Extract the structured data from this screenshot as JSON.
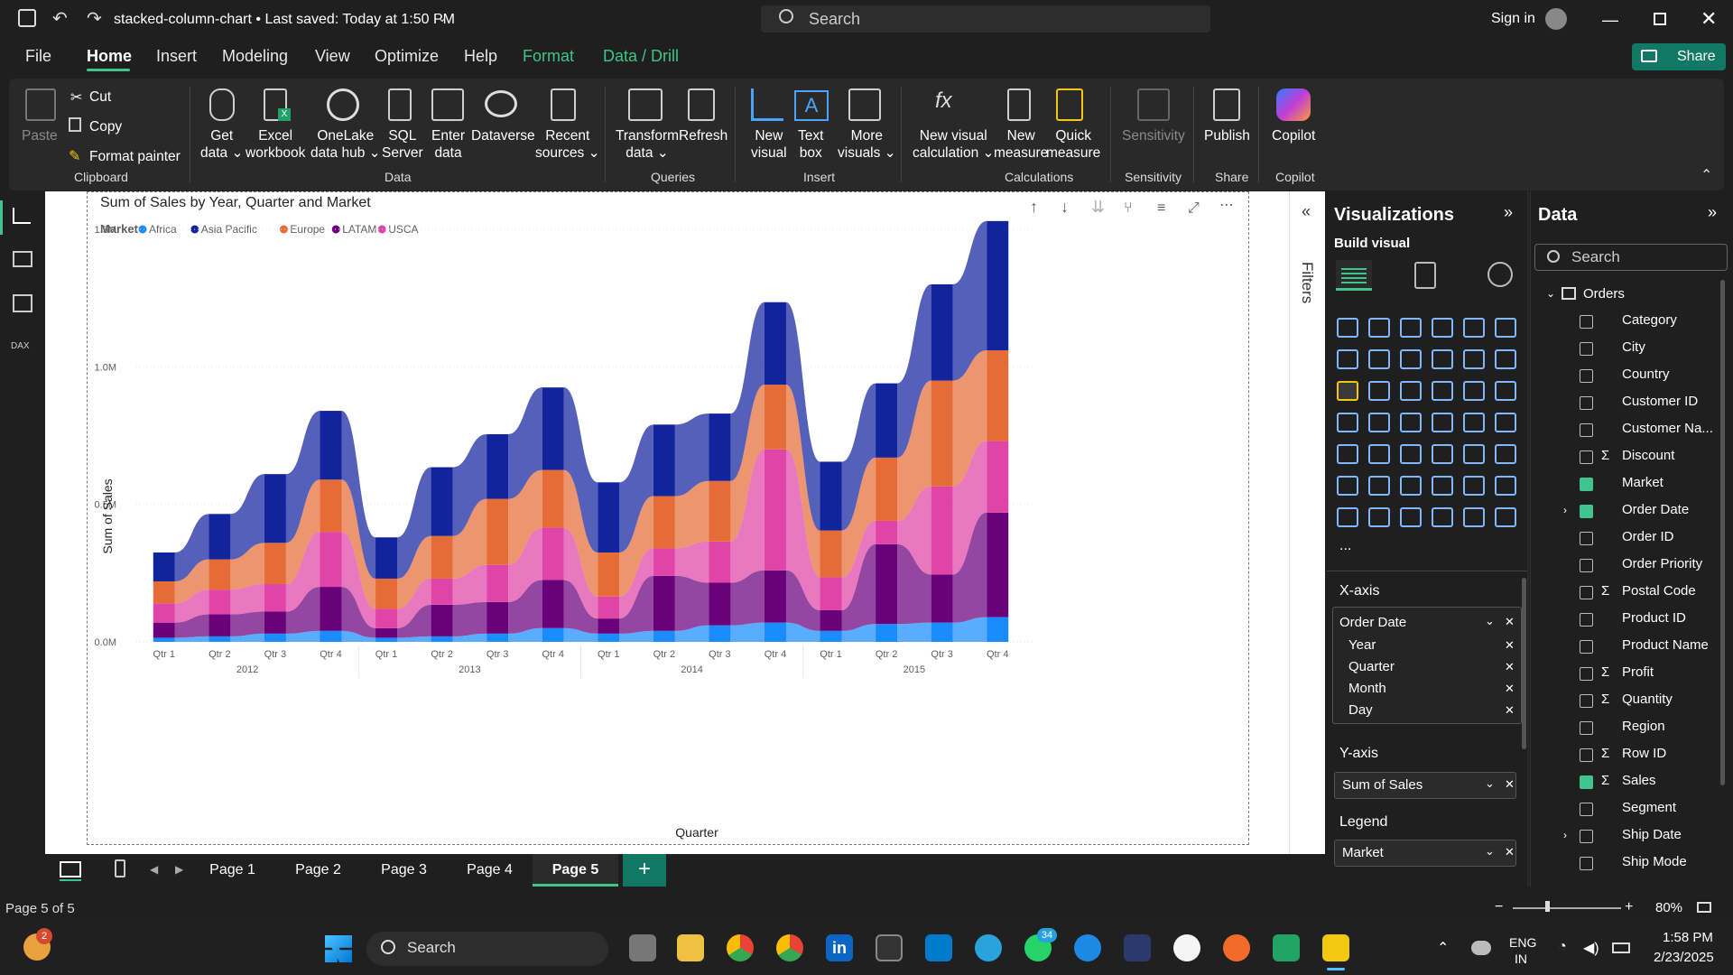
{
  "app": {
    "title": "stacked-column-chart • Last saved: Today at 1:50 PM",
    "search": "Search",
    "sign_in": "Sign in"
  },
  "menu": [
    "File",
    "Home",
    "Insert",
    "Modeling",
    "View",
    "Optimize",
    "Help",
    "Format",
    "Data / Drill"
  ],
  "share": "Share",
  "ribbon": {
    "paste": "Paste",
    "cut": "Cut",
    "copy": "Copy",
    "format_painter": "Format painter",
    "clipboard": "Clipboard",
    "get_data": [
      "Get",
      "data ⌄"
    ],
    "excel": [
      "Excel",
      "workbook"
    ],
    "onelake": [
      "OneLake",
      "data hub ⌄"
    ],
    "sql": [
      "SQL",
      "Server"
    ],
    "enter": [
      "Enter",
      "data"
    ],
    "dataverse": "Dataverse",
    "recent": [
      "Recent",
      "sources ⌄"
    ],
    "data_group": "Data",
    "transform": [
      "Transform",
      "data ⌄"
    ],
    "refresh": "Refresh",
    "queries_group": "Queries",
    "new_visual": [
      "New",
      "visual"
    ],
    "text_box": [
      "Text",
      "box"
    ],
    "more_visuals": [
      "More",
      "visuals ⌄"
    ],
    "insert_group": "Insert",
    "new_visual_calc": [
      "New visual",
      "calculation ⌄"
    ],
    "new_measure": [
      "New",
      "measure"
    ],
    "quick_measure": [
      "Quick",
      "measure"
    ],
    "calculations_group": "Calculations",
    "sensitivity": "Sensitivity",
    "sensitivity_group": "Sensitivity",
    "publish": "Publish",
    "share_group": "Share",
    "copilot": "Copilot",
    "copilot_group": "Copilot"
  },
  "chart_data": {
    "type": "ribbon-stacked-column",
    "title": "Sum of Sales by Year, Quarter and Market",
    "legend_title": "Market",
    "legend_position": "top-left",
    "xlabel": "Quarter",
    "ylabel": "Sum of Sales",
    "ylim": [
      0,
      1500000
    ],
    "y_ticks": [
      "0.0M",
      "0.5M",
      "1.0M",
      "1.5M"
    ],
    "categories": [
      "Qtr 1",
      "Qtr 2",
      "Qtr 3",
      "Qtr 4",
      "Qtr 1",
      "Qtr 2",
      "Qtr 3",
      "Qtr 4",
      "Qtr 1",
      "Qtr 2",
      "Qtr 3",
      "Qtr 4",
      "Qtr 1",
      "Qtr 2",
      "Qtr 3",
      "Qtr 4"
    ],
    "years": [
      "2012",
      "2013",
      "2014",
      "2015"
    ],
    "series": [
      {
        "name": "Africa",
        "color": "#1a8cff",
        "values": [
          15000,
          20000,
          30000,
          40000,
          15000,
          20000,
          30000,
          50000,
          30000,
          40000,
          60000,
          70000,
          40000,
          65000,
          70000,
          90000
        ]
      },
      {
        "name": "LATAM",
        "color": "#6b007b",
        "values": [
          55000,
          80000,
          80000,
          160000,
          35000,
          115000,
          115000,
          175000,
          55000,
          200000,
          155000,
          190000,
          75000,
          290000,
          175000,
          380000
        ]
      },
      {
        "name": "USCA",
        "color": "#e044a7",
        "values": [
          70000,
          90000,
          100000,
          200000,
          70000,
          95000,
          135000,
          190000,
          80000,
          100000,
          150000,
          440000,
          120000,
          85000,
          320000,
          260000
        ]
      },
      {
        "name": "Europe",
        "color": "#e66c37",
        "values": [
          80000,
          110000,
          150000,
          190000,
          110000,
          155000,
          240000,
          210000,
          160000,
          190000,
          220000,
          235000,
          170000,
          230000,
          385000,
          330000
        ]
      },
      {
        "name": "Asia Pacific",
        "color": "#12239e",
        "values": [
          105000,
          165000,
          250000,
          250000,
          150000,
          250000,
          235000,
          300000,
          255000,
          260000,
          245000,
          300000,
          250000,
          270000,
          350000,
          470000
        ]
      }
    ]
  },
  "visuals_pane": {
    "title": "Visualizations",
    "build": "Build visual",
    "xaxis_label": "X-axis",
    "xaxis_field": "Order Date",
    "xaxis_items": [
      "Year",
      "Quarter",
      "Month",
      "Day"
    ],
    "yaxis_label": "Y-axis",
    "yaxis_field": "Sum of Sales",
    "legend_label": "Legend",
    "legend_field": "Market",
    "more": "..."
  },
  "filters_label": "Filters",
  "data_pane": {
    "title": "Data",
    "search": "Search",
    "table": "Orders",
    "fields": [
      {
        "name": "Category",
        "sigma": false,
        "checked": false
      },
      {
        "name": "City",
        "sigma": false,
        "checked": false
      },
      {
        "name": "Country",
        "sigma": false,
        "checked": false
      },
      {
        "name": "Customer ID",
        "sigma": false,
        "checked": false
      },
      {
        "name": "Customer Na...",
        "sigma": false,
        "checked": false
      },
      {
        "name": "Discount",
        "sigma": true,
        "checked": false
      },
      {
        "name": "Market",
        "sigma": false,
        "checked": true
      },
      {
        "name": "Order Date",
        "sigma": false,
        "checked": true
      },
      {
        "name": "Order ID",
        "sigma": false,
        "checked": false
      },
      {
        "name": "Order Priority",
        "sigma": false,
        "checked": false
      },
      {
        "name": "Postal Code",
        "sigma": true,
        "checked": false
      },
      {
        "name": "Product ID",
        "sigma": false,
        "checked": false
      },
      {
        "name": "Product Name",
        "sigma": false,
        "checked": false
      },
      {
        "name": "Profit",
        "sigma": true,
        "checked": false
      },
      {
        "name": "Quantity",
        "sigma": true,
        "checked": false
      },
      {
        "name": "Region",
        "sigma": false,
        "checked": false
      },
      {
        "name": "Row ID",
        "sigma": true,
        "checked": false
      },
      {
        "name": "Sales",
        "sigma": true,
        "checked": true
      },
      {
        "name": "Segment",
        "sigma": false,
        "checked": false
      },
      {
        "name": "Ship Date",
        "sigma": false,
        "checked": false
      },
      {
        "name": "Ship Mode",
        "sigma": false,
        "checked": false
      }
    ]
  },
  "pages": [
    "Page 1",
    "Page 2",
    "Page 3",
    "Page 4",
    "Page 5"
  ],
  "status": {
    "page": "Page 5 of 5",
    "zoom": "80%"
  },
  "taskbar": {
    "search": "Search",
    "lang1": "ENG",
    "lang2": "IN",
    "time": "1:58 PM",
    "date": "2/23/2025",
    "badge1": "2",
    "badge2": "34"
  }
}
